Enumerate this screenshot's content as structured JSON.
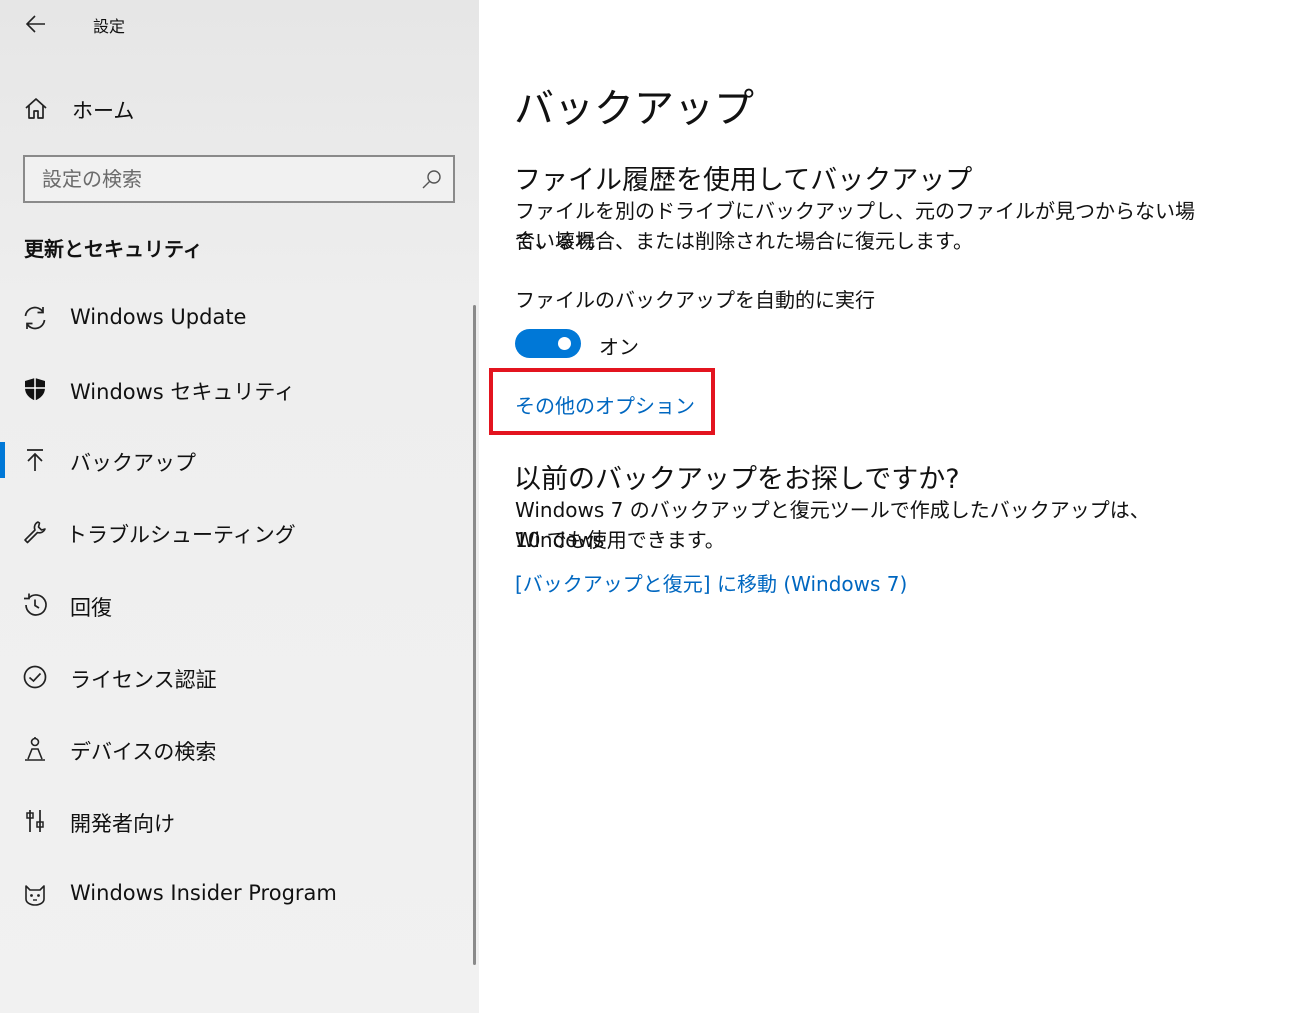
{
  "window": {
    "title": "設定"
  },
  "sidebar": {
    "home_label": "ホーム",
    "search_placeholder": "設定の検索",
    "section_title": "更新とセキュリティ",
    "items": [
      {
        "label": "Windows Update",
        "icon": "sync-icon",
        "selected": false
      },
      {
        "label": "Windows セキュリティ",
        "icon": "shield-icon",
        "selected": false
      },
      {
        "label": "バックアップ",
        "icon": "backup-arrow-icon",
        "selected": true
      },
      {
        "label": "トラブルシューティング",
        "icon": "wrench-icon",
        "selected": false
      },
      {
        "label": "回復",
        "icon": "history-icon",
        "selected": false
      },
      {
        "label": "ライセンス認証",
        "icon": "check-circle-icon",
        "selected": false
      },
      {
        "label": "デバイスの検索",
        "icon": "person-location-icon",
        "selected": false
      },
      {
        "label": "開発者向け",
        "icon": "developer-tools-icon",
        "selected": false
      },
      {
        "label": "Windows Insider Program",
        "icon": "insider-cat-icon",
        "selected": false
      }
    ]
  },
  "content": {
    "page_title": "バックアップ",
    "file_history": {
      "heading": "ファイル履歴を使用してバックアップ",
      "description_line1": "ファイルを別のドライブにバックアップし、元のファイルが見つからない場合、壊れ",
      "description_line2": "ている場合、または削除された場合に復元します。",
      "auto_backup_label": "ファイルのバックアップを自動的に実行",
      "toggle_state": "オン",
      "toggle_on": true,
      "more_options_link": "その他のオプション"
    },
    "older_backup": {
      "heading": "以前のバックアップをお探しですか?",
      "description_line1": "Windows 7 のバックアップと復元ツールで作成したバックアップは、Windows",
      "description_line2": "10 でも使用できます。",
      "link": "[バックアップと復元] に移動 (Windows 7)"
    }
  },
  "colors": {
    "accent": "#0078d7",
    "link": "#0067c0",
    "highlight": "#e3141f"
  }
}
